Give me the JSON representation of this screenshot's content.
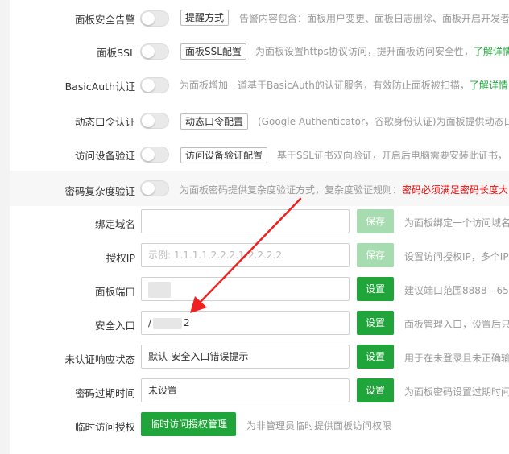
{
  "rows": [
    {
      "label": "面板安全告警",
      "button": "提醒方式",
      "desc": "告警内容包含：面板用户变更、面板日志删除、面板开启开发者"
    },
    {
      "label": "面板SSL",
      "button": "面板SSL配置",
      "desc": "为面板设置https协议访问，提升面板访问安全性，",
      "link": "了解详情"
    },
    {
      "label": "BasicAuth认证",
      "desc": "为面板增加一道基于BasicAuth的认证服务，有效防止面板被扫描，",
      "link": "了解详情"
    },
    {
      "label": "动态口令认证",
      "button": "动态口令配置",
      "desc": "(Google Authenticator，谷歌身份认证)为面板提供动态口"
    },
    {
      "label": "访问设备验证",
      "button": "访问设备验证配置",
      "desc": "基于SSL证书双向验证，开启后电脑需要安装此证书，"
    },
    {
      "label": "密码复杂度验证",
      "desc": "为面板密码提供复杂度验证方式，复杂度验证规则：",
      "warn": "密码必须满足密码长度大"
    }
  ],
  "fields": [
    {
      "label": "绑定域名",
      "value": "",
      "placeholder": "",
      "button": "保存",
      "desc": "为面板绑定一个访问域名"
    },
    {
      "label": "授权IP",
      "value": "",
      "placeholder": "示例: 1.1.1.1,2.2.2.1-2.2.2.2",
      "button": "保存",
      "desc": "设置访问授权IP，多个IP"
    },
    {
      "label": "面板端口",
      "value": "",
      "button": "设置",
      "desc": "建议端口范围8888 - 65"
    },
    {
      "label": "安全入口",
      "value_prefix": "/",
      "value_suffix": "2",
      "button": "设置",
      "desc": "面板管理入口，设置后只"
    },
    {
      "label": "未认证响应状态",
      "value": "默认-安全入口错误提示",
      "button": "设置",
      "desc": "用于在未登录且未正确输"
    },
    {
      "label": "密码过期时间",
      "value": "未设置",
      "button": "设置",
      "desc": "为面板密码设置过期时间"
    }
  ],
  "temp_access": {
    "label": "临时访问授权",
    "button": "临时访问授权管理",
    "desc": "为非管理员临时提供面板访问权限"
  },
  "colors": {
    "accent": "#20a53a",
    "warn": "#ef0808",
    "arrow": "#f02020"
  }
}
